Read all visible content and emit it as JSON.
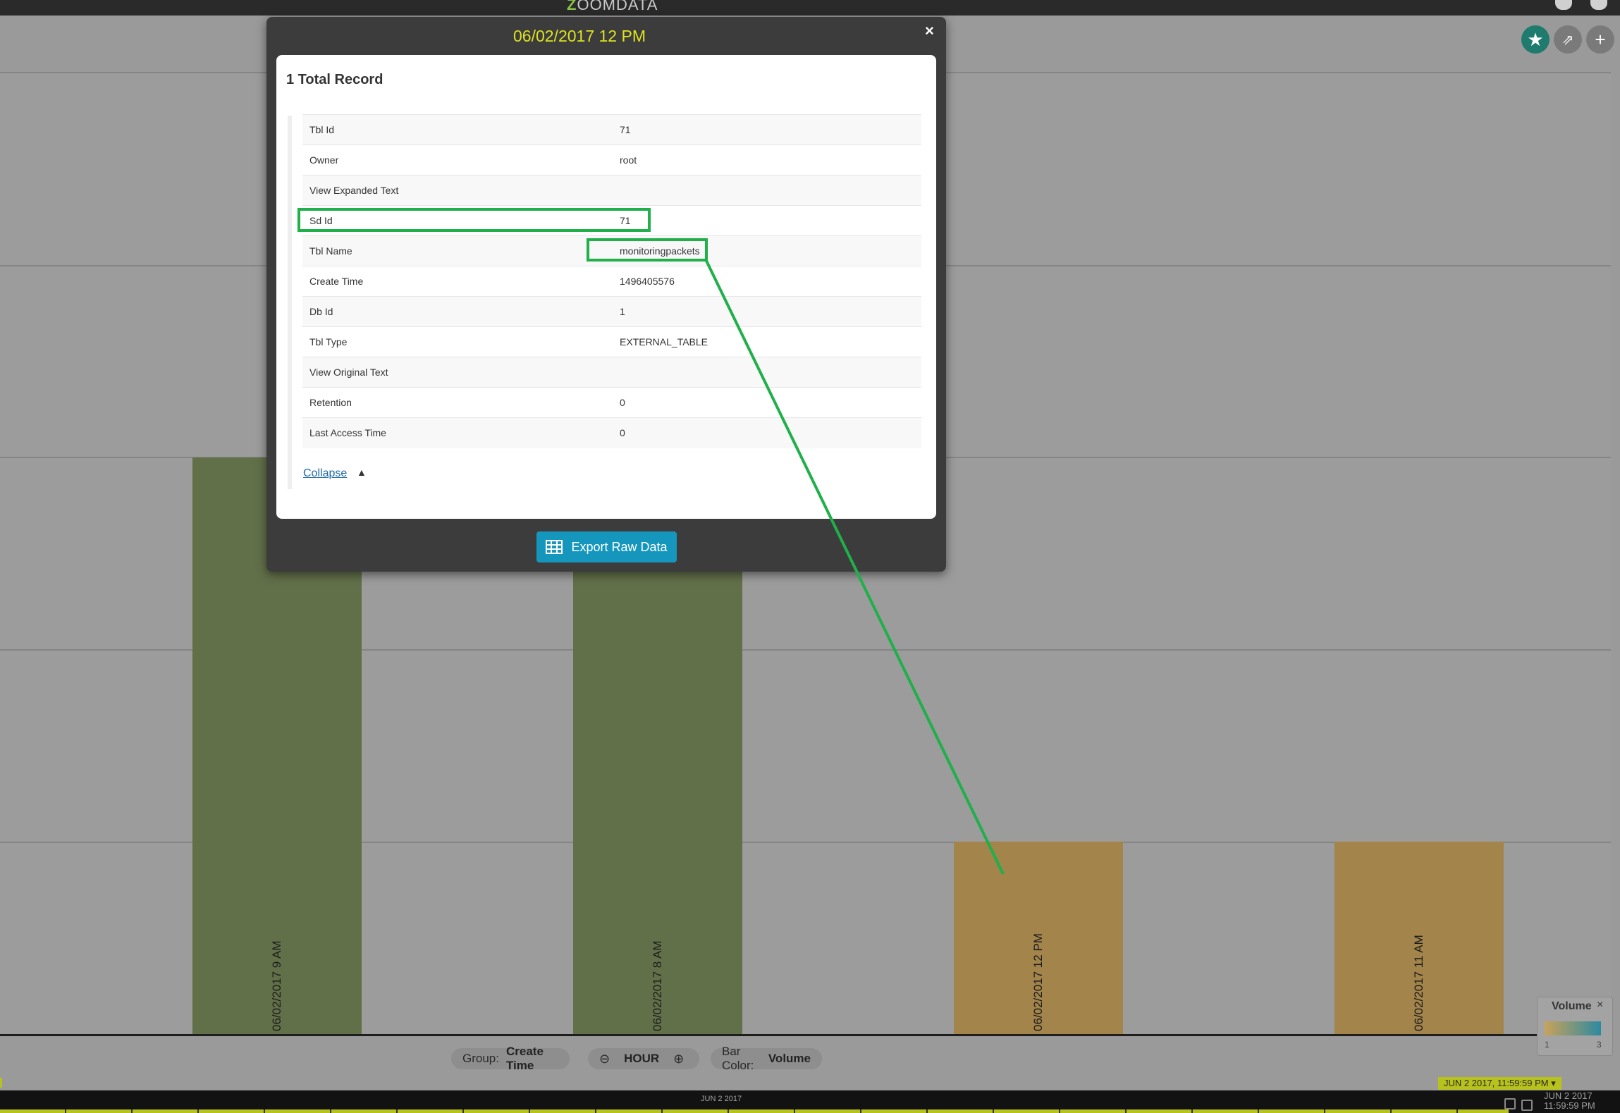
{
  "app": {
    "logo_text": "OOMDATA",
    "logo_initial": "Z"
  },
  "modal": {
    "title": "06/02/2017 12 PM",
    "close_glyph": "×",
    "record_count": "1 Total Record",
    "rows": [
      {
        "key": "Tbl Id",
        "value": "71"
      },
      {
        "key": "Owner",
        "value": "root"
      },
      {
        "key": "View Expanded Text",
        "value": ""
      },
      {
        "key": "Sd Id",
        "value": "71"
      },
      {
        "key": "Tbl Name",
        "value": "monitoringpackets"
      },
      {
        "key": "Create Time",
        "value": "1496405576"
      },
      {
        "key": "Db Id",
        "value": "1"
      },
      {
        "key": "Tbl Type",
        "value": "EXTERNAL_TABLE"
      },
      {
        "key": "View Original Text",
        "value": ""
      },
      {
        "key": "Retention",
        "value": "0"
      },
      {
        "key": "Last Access Time",
        "value": "0"
      }
    ],
    "collapse_label": "Collapse",
    "export_label": "Export Raw Data"
  },
  "controls": {
    "group_label": "Group:",
    "group_value": "Create Time",
    "time_unit": "HOUR",
    "bar_color_label": "Bar Color:",
    "bar_color_value": "Volume"
  },
  "legend": {
    "title": "Volume",
    "min": "1",
    "max": "3",
    "close_glyph": "×"
  },
  "timeline": {
    "center_label": "JUN 2 2017",
    "badge": "JUN 2 2017, 11:59:59 PM",
    "right_line1": "JUN 2 2017",
    "right_line2": "11:59:59 PM"
  },
  "colors": {
    "accent": "#dde320",
    "button": "#1597bd",
    "annotation": "#1fb04a",
    "bar_high": "#627049",
    "bar_low": "#a3844b"
  },
  "icons": [
    "help-icon",
    "user-icon",
    "star-icon",
    "share-icon",
    "plus-icon",
    "table-icon",
    "chevron-up-icon",
    "zoom-out-icon",
    "zoom-in-icon",
    "close-icon",
    "calendar-icon"
  ],
  "chart_data": {
    "type": "bar",
    "categories": [
      "06/02/2017 9 AM",
      "06/02/2017 8 AM",
      "06/02/2017 12 PM",
      "06/02/2017 11 AM"
    ],
    "values": [
      3,
      3,
      1,
      1
    ],
    "colors": [
      "#627049",
      "#627049",
      "#a3844b",
      "#a3844b"
    ],
    "ylim": [
      0,
      5
    ],
    "grid": true
  }
}
